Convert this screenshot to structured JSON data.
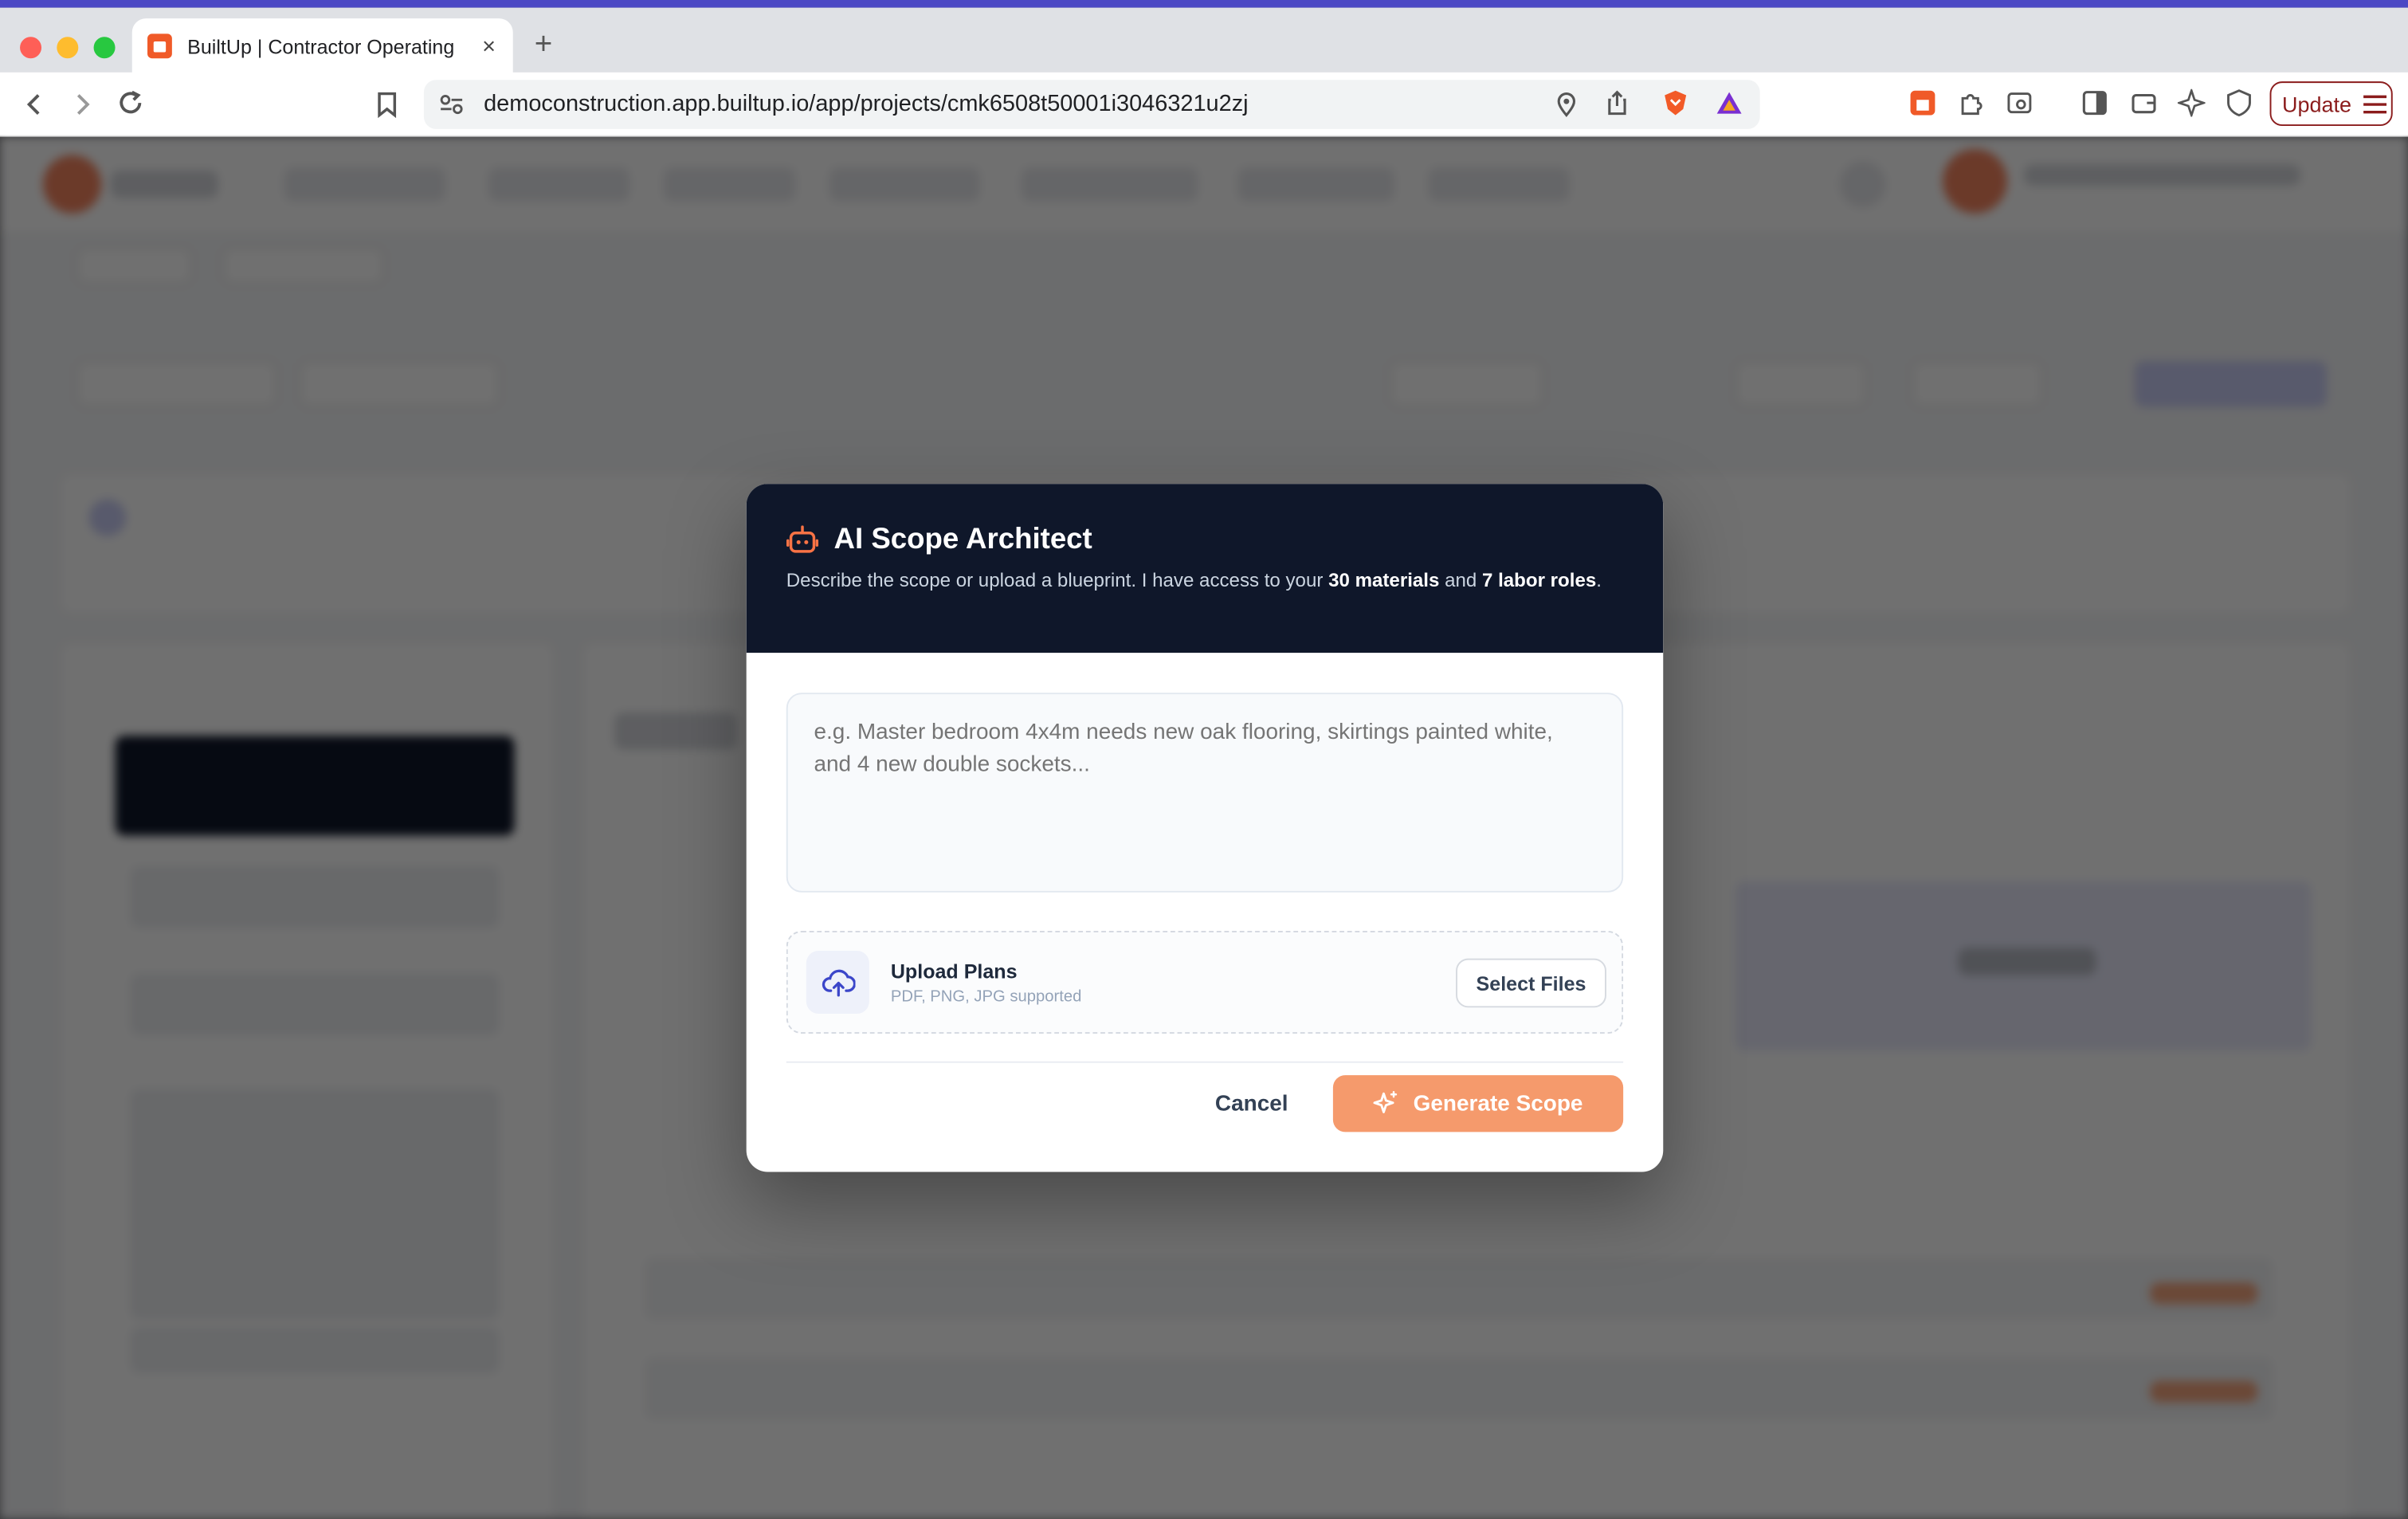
{
  "browser": {
    "tab_title": "BuiltUp | Contractor Operating",
    "tab_close": "×",
    "new_tab": "+",
    "url": "democonstruction.app.builtup.io/app/projects/cmk6508t50001i3046321u2zj",
    "update_label": "Update"
  },
  "modal": {
    "title": "AI Scope Architect",
    "desc_prefix": "Describe the scope or upload a blueprint. I have access to your ",
    "materials_count": "30 materials",
    "desc_and": " and ",
    "labor_count": "7 labor roles",
    "desc_suffix": ".",
    "scope_placeholder": "e.g. Master bedroom 4x4m needs new oak flooring, skirtings painted white, and 4 new double sockets...",
    "upload_title": "Upload Plans",
    "upload_subtitle": "PDF, PNG, JPG supported",
    "select_files_label": "Select Files",
    "cancel_label": "Cancel",
    "generate_label": "Generate Scope"
  },
  "colors": {
    "modal_header": "#0f172a",
    "accent_orange": "#f59a6c",
    "brand_orange": "#f05a28"
  },
  "icons": {
    "header": "robot-icon",
    "upload": "cloud-upload-icon",
    "generate": "sparkles-icon"
  }
}
